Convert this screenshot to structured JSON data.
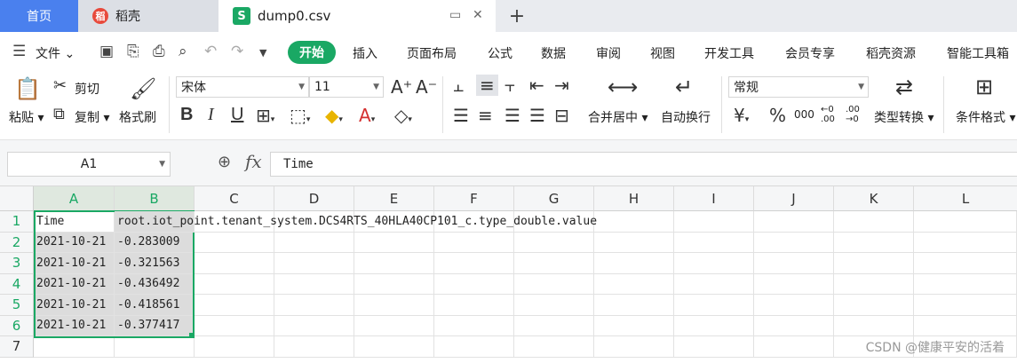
{
  "tabs": {
    "home": "首页",
    "daoke": "稻壳",
    "file": "dump0.csv",
    "daoke_logo": "稻",
    "file_logo": "S"
  },
  "menu": {
    "file": "文件",
    "start": "开始",
    "items": [
      "插入",
      "页面布局",
      "公式",
      "数据",
      "审阅",
      "视图",
      "开发工具",
      "会员专享",
      "稻壳资源",
      "智能工具箱"
    ]
  },
  "ribbon": {
    "paste": "粘贴",
    "cut": "剪切",
    "copy": "复制",
    "format_painter": "格式刷",
    "font_name": "宋体",
    "font_size": "11",
    "merge_center": "合并居中",
    "wrap_text": "自动换行",
    "number_format": "常规",
    "type_convert": "类型转换",
    "conditional_format": "条件格式",
    "bold": "B",
    "italic": "I",
    "underline": "U",
    "percent": "%",
    "thousands": "000",
    "dec_add": "←0 .00",
    "dec_remove": ".00 →0"
  },
  "formula_bar": {
    "name_box": "A1",
    "fx": "fx",
    "value": "Time"
  },
  "columns": [
    "A",
    "B",
    "C",
    "D",
    "E",
    "F",
    "G",
    "H",
    "I",
    "J",
    "K",
    "L"
  ],
  "rows": [
    "1",
    "2",
    "3",
    "4",
    "5",
    "6",
    "7"
  ],
  "cells": {
    "r1": {
      "a": "Time",
      "b": "root.iot_point.tenant_system.DCS4RTS_40HLA40CP101_c.type_double.value"
    },
    "r2": {
      "a": "2021-10-21",
      "b": "-0.283009"
    },
    "r3": {
      "a": "2021-10-21",
      "b": "-0.321563"
    },
    "r4": {
      "a": "2021-10-21",
      "b": "-0.436492"
    },
    "r5": {
      "a": "2021-10-21",
      "b": "-0.418561"
    },
    "r6": {
      "a": "2021-10-21",
      "b": "-0.377417"
    }
  },
  "watermark": "CSDN @健康平安的活着"
}
